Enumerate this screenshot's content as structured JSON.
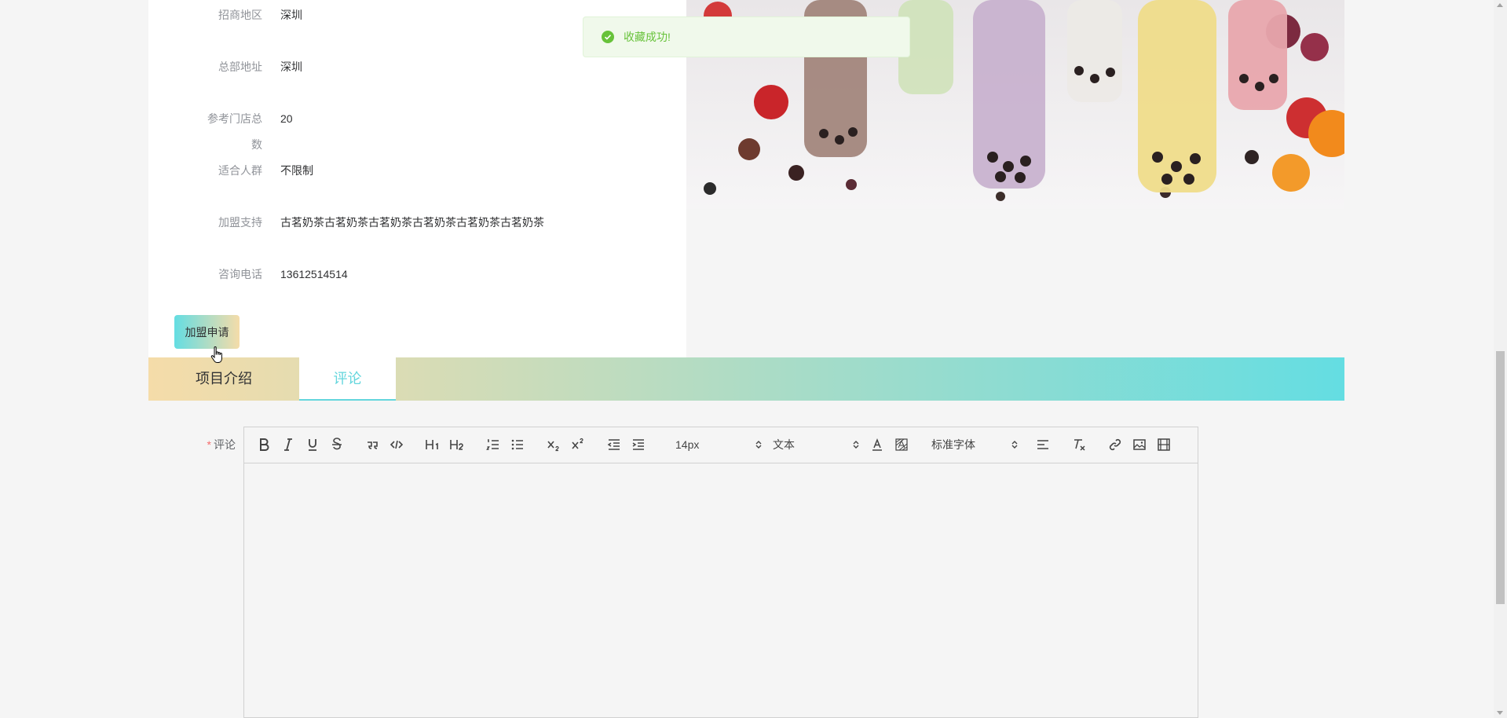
{
  "toast": {
    "message": "收藏成功!",
    "color": "#67c23a"
  },
  "info": {
    "rows": [
      {
        "label": "招商地区",
        "value": "深圳"
      },
      {
        "label": "总部地址",
        "value": "深圳"
      },
      {
        "label": "参考门店总数",
        "value": "20"
      },
      {
        "label": "适合人群",
        "value": "不限制"
      },
      {
        "label": "加盟支持",
        "value": "古茗奶茶古茗奶茶古茗奶茶古茗奶茶古茗奶茶古茗奶茶"
      },
      {
        "label": "咨询电话",
        "value": "13612514514"
      }
    ],
    "join_button": "加盟申请"
  },
  "tabs": [
    {
      "label": "项目介绍",
      "active": false
    },
    {
      "label": "评论",
      "active": true
    }
  ],
  "comment_form": {
    "required_mark": "*",
    "label": "评论",
    "toolbar": {
      "buttons": [
        "bold-icon",
        "italic-icon",
        "underline-icon",
        "strike-icon",
        "blockquote-icon",
        "code-block-icon",
        "header-1-icon",
        "header-2-icon",
        "ordered-list-icon",
        "bullet-list-icon",
        "subscript-icon",
        "superscript-icon",
        "outdent-icon",
        "indent-icon",
        "font-color-icon",
        "background-color-icon",
        "align-icon",
        "clean-format-icon",
        "link-icon",
        "image-icon",
        "video-icon"
      ],
      "size_select": "14px",
      "header_select": "文本",
      "font_select": "标准字体"
    }
  },
  "colors": {
    "accent": "#64d6dd",
    "gradient_start": "#f5dca9",
    "gradient_end": "#64dde2"
  }
}
